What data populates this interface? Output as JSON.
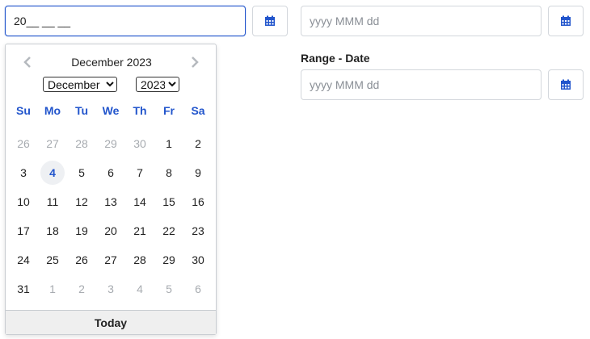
{
  "left_picker": {
    "input_value": "20__ __ __",
    "calendar_icon": "calendar-icon"
  },
  "right_picker": {
    "placeholder": "yyyy MMM dd",
    "calendar_icon": "calendar-icon"
  },
  "range": {
    "label": "Range - Date",
    "placeholder": "yyyy MMM dd",
    "calendar_icon": "calendar-icon"
  },
  "calendar": {
    "title": "December 2023",
    "month_select": "December",
    "year_select": "2023",
    "prev_icon": "chevron-left-icon",
    "next_icon": "chevron-right-icon",
    "weekdays": [
      "Su",
      "Mo",
      "Tu",
      "We",
      "Th",
      "Fr",
      "Sa"
    ],
    "weeks": [
      [
        "26",
        "27",
        "28",
        "29",
        "30",
        "1",
        "2"
      ],
      [
        "3",
        "4",
        "5",
        "6",
        "7",
        "8",
        "9"
      ],
      [
        "10",
        "11",
        "12",
        "13",
        "14",
        "15",
        "16"
      ],
      [
        "17",
        "18",
        "19",
        "20",
        "21",
        "22",
        "23"
      ],
      [
        "24",
        "25",
        "26",
        "27",
        "28",
        "29",
        "30"
      ],
      [
        "31",
        "1",
        "2",
        "3",
        "4",
        "5",
        "6"
      ]
    ],
    "today_day": "4",
    "today_label": "Today"
  },
  "colors": {
    "accent": "#2255cc",
    "muted": "#a7abb0",
    "border": "#d3d7dc"
  }
}
